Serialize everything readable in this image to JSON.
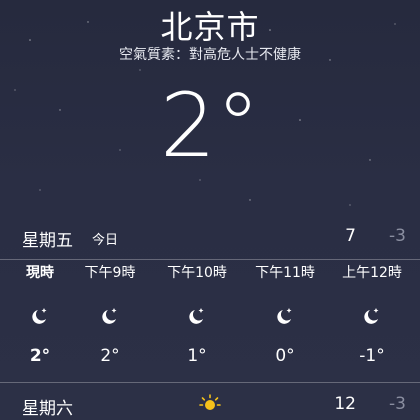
{
  "location": {
    "city": "北京市",
    "air_quality": "空氣質素：對高危人士不健康",
    "current_temp": "2°"
  },
  "today": {
    "day": "星期五",
    "tag": "今日",
    "high": "7",
    "low": "-3"
  },
  "hourly": [
    {
      "label": "現時",
      "icon": "moon-stars-icon",
      "temp": "2°"
    },
    {
      "label": "下午9時",
      "icon": "moon-stars-icon",
      "temp": "2°"
    },
    {
      "label": "下午10時",
      "icon": "moon-stars-icon",
      "temp": "1°"
    },
    {
      "label": "下午11時",
      "icon": "moon-stars-icon",
      "temp": "0°"
    },
    {
      "label": "上午12時",
      "icon": "moon-stars-icon",
      "temp": "-1°"
    }
  ],
  "forecast": [
    {
      "day": "星期六",
      "icon": "sun-icon",
      "high": "12",
      "low": "-3"
    }
  ],
  "colors": {
    "background": "#2a2e44",
    "low_temp": "#8a8ea0",
    "sun": "#f6c21b"
  }
}
